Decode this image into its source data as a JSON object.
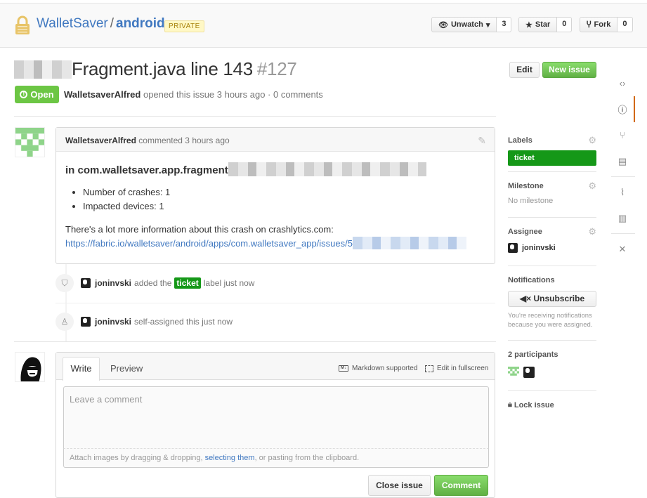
{
  "repo": {
    "owner": "WalletSaver",
    "separator": "/",
    "name": "android",
    "visibility": "PRIVATE"
  },
  "actions": {
    "watch": {
      "label": "Unwatch",
      "count": "3"
    },
    "star": {
      "label": "Star",
      "count": "0"
    },
    "fork": {
      "label": "Fork",
      "count": "0"
    }
  },
  "issue": {
    "title": "Fragment.java line 143",
    "number": "#127",
    "state": "Open",
    "author": "WalletsaverAlfred",
    "meta_text": "opened this issue 3 hours ago · 0 comments",
    "edit_label": "Edit",
    "new_issue_label": "New issue"
  },
  "comment": {
    "author": "WalletsaverAlfred",
    "time": "commented 3 hours ago",
    "heading": "in com.walletsaver.app.fragment",
    "bullets": [
      "Number of crashes: 1",
      "Impacted devices: 1"
    ],
    "info_text": "There's a lot more information about this crash on crashlytics.com:",
    "link_text": "https://fabric.io/walletsaver/android/apps/com.walletsaver_app/issues/5"
  },
  "events": [
    {
      "user": "joninvski",
      "before": "added the",
      "label": "ticket",
      "after": "label just now"
    },
    {
      "user": "joninvski",
      "text": "self-assigned this just now"
    }
  ],
  "form": {
    "tab_write": "Write",
    "tab_preview": "Preview",
    "markdown_help": "Markdown supported",
    "fullscreen_help": "Edit in fullscreen",
    "placeholder": "Leave a comment",
    "attach_before": "Attach images by dragging & dropping, ",
    "attach_link": "selecting them",
    "attach_after": ", or pasting from the clipboard.",
    "close_label": "Close issue",
    "comment_label": "Comment"
  },
  "sidebar": {
    "labels": {
      "heading": "Labels",
      "items": [
        "ticket"
      ]
    },
    "milestone": {
      "heading": "Milestone",
      "value": "No milestone"
    },
    "assignee": {
      "heading": "Assignee",
      "user": "joninvski"
    },
    "notifications": {
      "heading": "Notifications",
      "button": "Unsubscribe",
      "note": "You're receiving notifications because you were assigned."
    },
    "participants": {
      "heading": "2 participants"
    },
    "lock": "Lock issue"
  },
  "colors": {
    "accent": "#4078c0",
    "open_green": "#6cc644",
    "label_green": "#159818",
    "nav_active": "#d26911"
  }
}
